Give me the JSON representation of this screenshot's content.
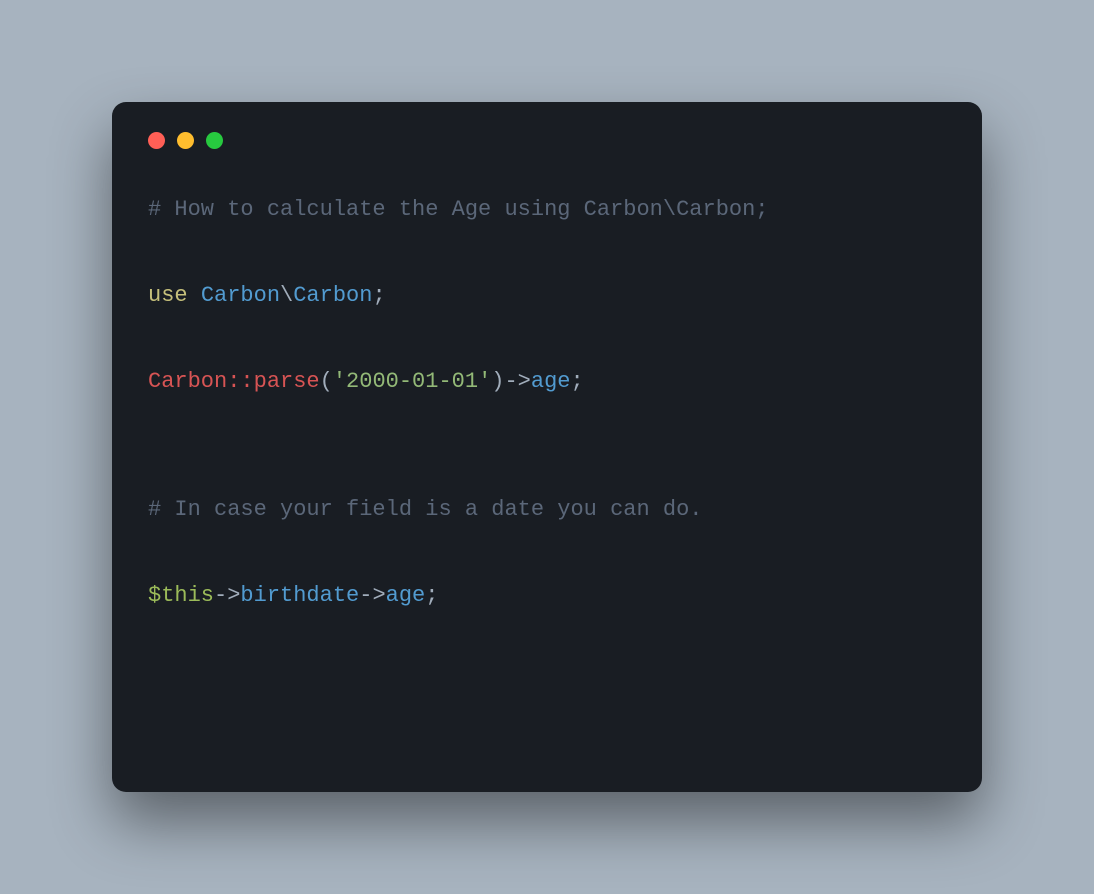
{
  "code": {
    "comment1": "# How to calculate the Age using Carbon\\Carbon;",
    "kw_use": "use",
    "ns1": "Carbon",
    "ns_sep": "\\",
    "ns2": "Carbon",
    "semicolon": ";",
    "call_class": "Carbon::parse",
    "paren_open": "(",
    "str_date": "'2000-01-01'",
    "paren_close": ")",
    "arrow": "->",
    "prop_age": "age",
    "comment2": "# In case your field is a date you can do.",
    "var_this": "$this",
    "prop_birthdate": "birthdate"
  }
}
